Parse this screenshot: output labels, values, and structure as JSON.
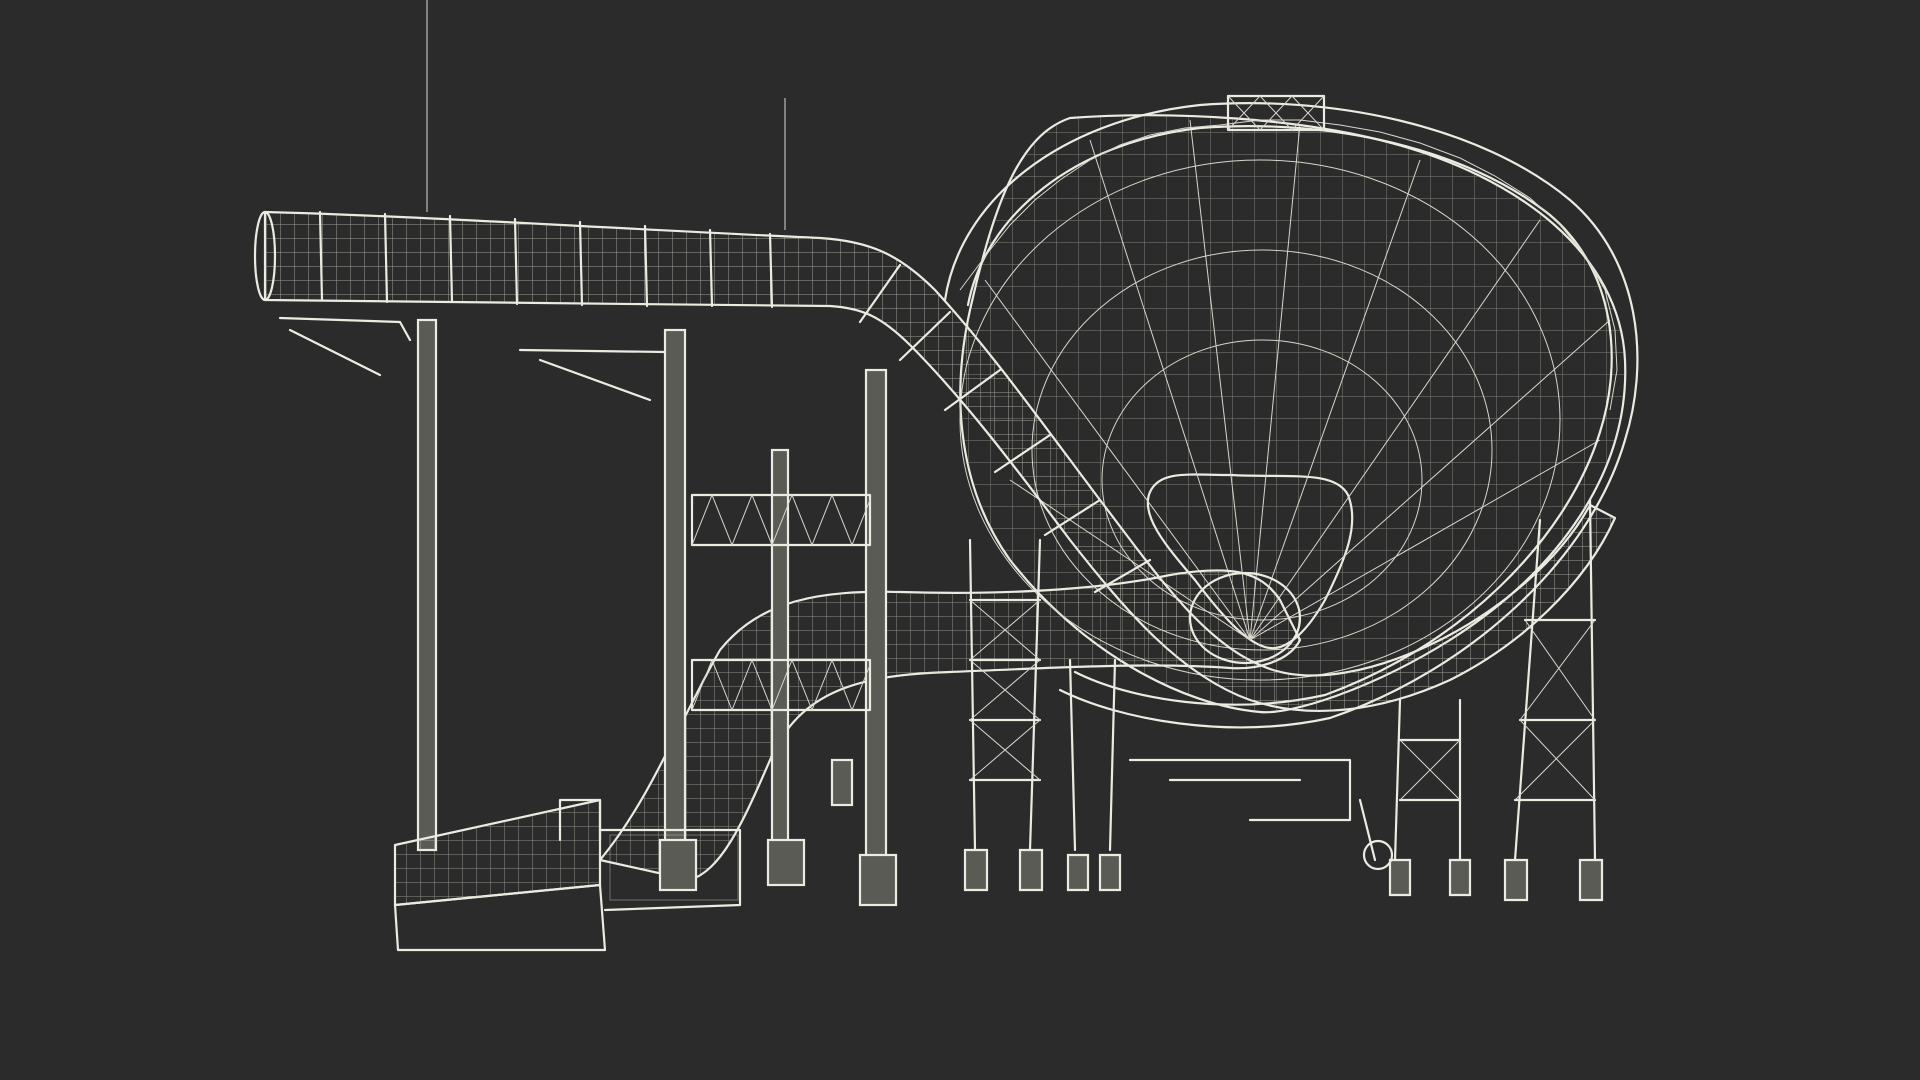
{
  "scene": {
    "subject": "",
    "background_color": "#2b2b2b",
    "wire_color": "#ecebe2",
    "surface_color": "#5b5b55"
  },
  "icons": []
}
